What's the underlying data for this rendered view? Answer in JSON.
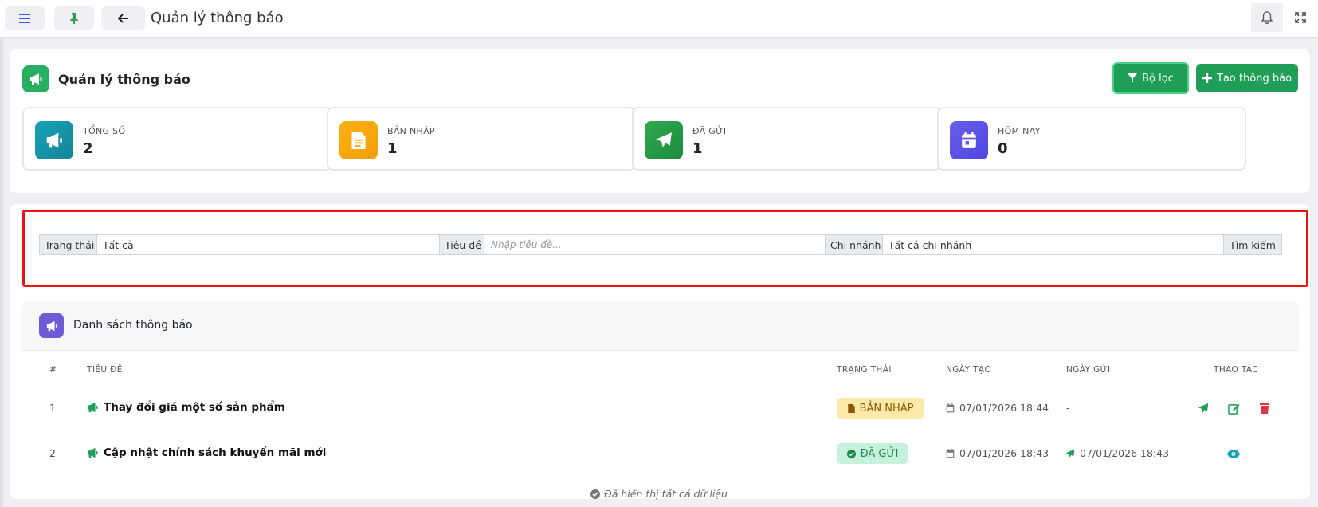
{
  "topbar": {
    "title": "Quản lý thông báo",
    "icons": [
      "menu-icon",
      "pin-icon",
      "back-arrow-icon",
      "bell-icon",
      "fullscreen-icon"
    ]
  },
  "header": {
    "title": "Quản lý thông báo",
    "filter_button": "Bộ lọc",
    "create_button": "Tạo thông báo"
  },
  "stats": [
    {
      "label": "TỔNG SỐ",
      "value": "2",
      "color": "#17a2b8",
      "icon": "megaphone-icon"
    },
    {
      "label": "BẢN NHÁP",
      "value": "1",
      "color": "#fdb010",
      "icon": "document-icon"
    },
    {
      "label": "ĐÃ GỬI",
      "value": "1",
      "color": "#28a745",
      "icon": "send-icon"
    },
    {
      "label": "HÔM NAY",
      "value": "0",
      "color": "#6058e8",
      "icon": "calendar-icon"
    }
  ],
  "filters": {
    "status_label": "Trạng thái",
    "status_value": "Tất cả",
    "title_label": "Tiêu đề",
    "title_placeholder": "Nhập tiêu đề...",
    "branch_label": "Chi nhánh",
    "branch_value": "Tất cả chi nhánh",
    "search_button": "Tìm kiếm"
  },
  "list": {
    "title": "Danh sách thông báo",
    "columns": [
      "#",
      "TIÊU ĐỀ",
      "TRẠNG THÁI",
      "NGÀY TẠO",
      "NGÀY GỬI",
      "THAO TÁC"
    ],
    "rows": [
      {
        "index": "1",
        "title": "Thay đổi giá một số sản phẩm",
        "status": "BẢN NHÁP",
        "created": "07/01/2026 18:44",
        "sent": "-"
      },
      {
        "index": "2",
        "title": "Cập nhật chính sách khuyến mãi mới",
        "status": "ĐÃ GỬI",
        "created": "07/01/2026 18:43",
        "sent": "07/01/2026 18:43"
      }
    ],
    "footer": "Đã hiển thị tất cả dữ liệu"
  },
  "colors": {
    "primary_green": "#1e9e57",
    "draft_badge_bg": "#fde9a9",
    "draft_badge_text": "#8a5a00",
    "sent_badge_bg": "#c8f1dd",
    "sent_badge_text": "#1a8a4a",
    "delete_red": "#dc3545",
    "view_teal": "#17a2b8",
    "highlight_red": "#ee1111"
  }
}
